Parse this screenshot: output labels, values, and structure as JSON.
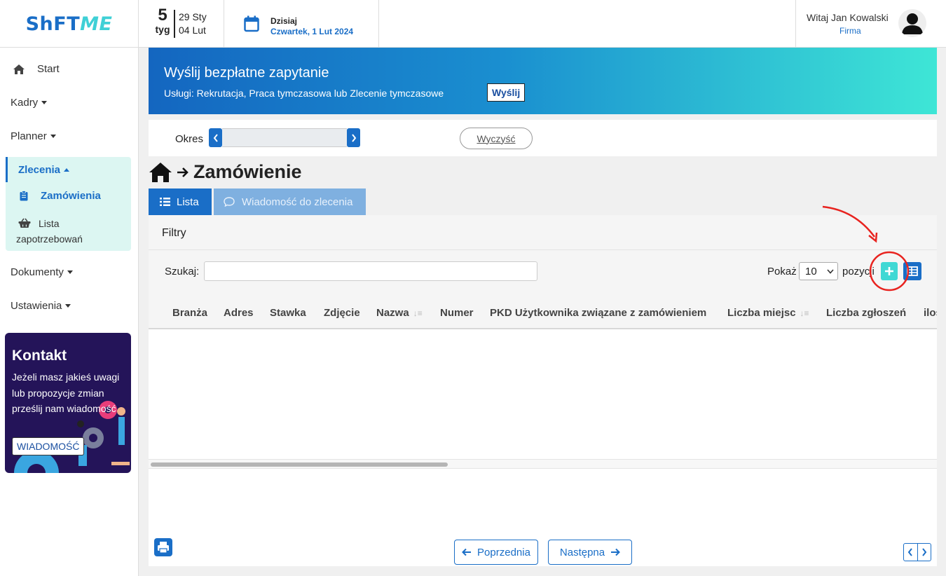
{
  "brand": {
    "part1": "ShFT",
    "part2": "ME",
    "color_main": "#1a6ec7",
    "color_accent": "#3fd0d6"
  },
  "week": {
    "number": "5",
    "label": "tyg",
    "start": "29 Sty",
    "end": "04 Lut"
  },
  "today": {
    "label": "Dzisiaj",
    "date": "Czwartek, 1 Lut 2024",
    "icon": "calendar-icon"
  },
  "user": {
    "greeting": "Witaj Jan Kowalski",
    "company": "Firma",
    "icon": "user-avatar-icon"
  },
  "sidebar": {
    "items": [
      {
        "label": "Start",
        "icon": "home-icon"
      },
      {
        "label": "Kadry"
      },
      {
        "label": "Planner"
      },
      {
        "label": "Dokumenty"
      },
      {
        "label": "Ustawienia"
      }
    ],
    "active_group": {
      "label": "Zlecenia",
      "sub_items": [
        {
          "label": "Zamówienia",
          "icon": "clipboard-icon"
        },
        {
          "label": "Lista zapotrzebowań",
          "icon": "basket-icon"
        }
      ]
    }
  },
  "contact": {
    "title": "Kontakt",
    "text": "Jeżeli masz jakieś uwagi lub propozycje zmian prześlij nam wiadomość",
    "button": "WIADOMOŚĆ",
    "bg_color": "#241459"
  },
  "banner": {
    "title": "Wyślij bezpłatne zapytanie",
    "subtitle": "Usługi: Rekrutacja, Praca tymczasowa lub Zlecenie tymczasowe",
    "button": "Wyślij"
  },
  "period": {
    "label": "Okres",
    "value": "",
    "clear": "Wyczyść"
  },
  "breadcrumb": {
    "title": "Zamówienie",
    "home_icon": "home-icon",
    "arrow_icon": "arrow-right-icon"
  },
  "tabs": [
    {
      "label": "Lista",
      "icon": "list-icon",
      "active": true
    },
    {
      "label": "Wiadomość do zlecenia",
      "icon": "chat-icon",
      "active": false
    }
  ],
  "filters": {
    "label": "Filtry"
  },
  "table_tools": {
    "search_label": "Szukaj:",
    "search_value": "",
    "show_label": "Pokaż",
    "page_size": "10",
    "positions_label": "pozycji",
    "add_icon": "plus-icon",
    "columns_icon": "columns-icon"
  },
  "table": {
    "columns": [
      {
        "label": "Branża"
      },
      {
        "label": "Adres"
      },
      {
        "label": "Stawka"
      },
      {
        "label": "Zdjęcie"
      },
      {
        "label": "Nazwa",
        "sortable": true
      },
      {
        "label": "Numer"
      },
      {
        "label": "PKD Użytkownika związane z zamówieniem"
      },
      {
        "label": "Liczba miejsc",
        "sortable": true
      },
      {
        "label": "Liczba zgłoszeń"
      },
      {
        "label": "iloś"
      }
    ],
    "rows": []
  },
  "pagination": {
    "prev": "Poprzednia",
    "next": "Następna",
    "print_icon": "printer-icon"
  },
  "annotation": {
    "color": "#e8231f"
  }
}
